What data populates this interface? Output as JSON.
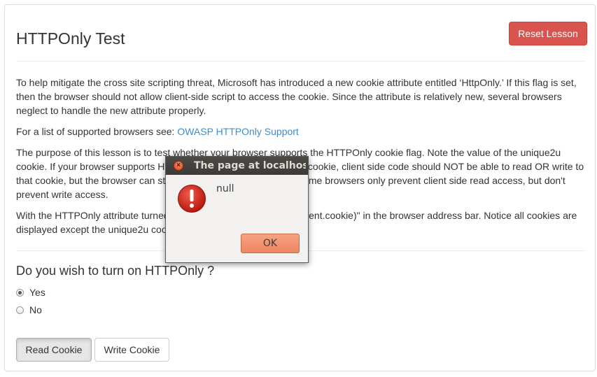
{
  "page": {
    "title": "HTTPOnly Test",
    "reset_label": "Reset Lesson"
  },
  "content": {
    "paragraph1": "To help mitigate the cross site scripting threat, Microsoft has introduced a new cookie attribute entitled ‘HttpOnly.’ If this flag is set, then the browser should not allow client-side script to access the cookie. Since the attribute is relatively new, several browsers neglect to handle the new attribute properly.",
    "paragraph2_prefix": "For a list of supported browsers see: ",
    "paragraph2_link": "OWASP HTTPOnly Support",
    "paragraph3": "The purpose of this lesson is to test whether your browser supports the HTTPOnly cookie flag. Note the value of the unique2u cookie. If your browser supports HTTPOnly, and you enable it for a cookie, client side code should NOT be able to read OR write to that cookie, but the browser can still send its value to the server. Some browsers only prevent client side read access, but don't prevent write access.",
    "paragraph4": "With the HTTPOnly attribute turned on, type \"javascript:alert(document.cookie)\" in the browser address bar. Notice all cookies are displayed except the unique2u cookie."
  },
  "form": {
    "question": "Do you wish to turn on HTTPOnly ?",
    "options": [
      {
        "label": "Yes",
        "checked": true
      },
      {
        "label": "No",
        "checked": false
      }
    ],
    "read_label": "Read Cookie",
    "write_label": "Write Cookie"
  },
  "dialog": {
    "title": "The page at localhost",
    "message": "null",
    "ok_label": "OK",
    "close_symbol": "×",
    "icon": "error-icon"
  },
  "colors": {
    "danger": "#d9534f",
    "link": "#428bca",
    "dialog_ok": "#ec8662",
    "titlebar": "#3c3b37"
  }
}
